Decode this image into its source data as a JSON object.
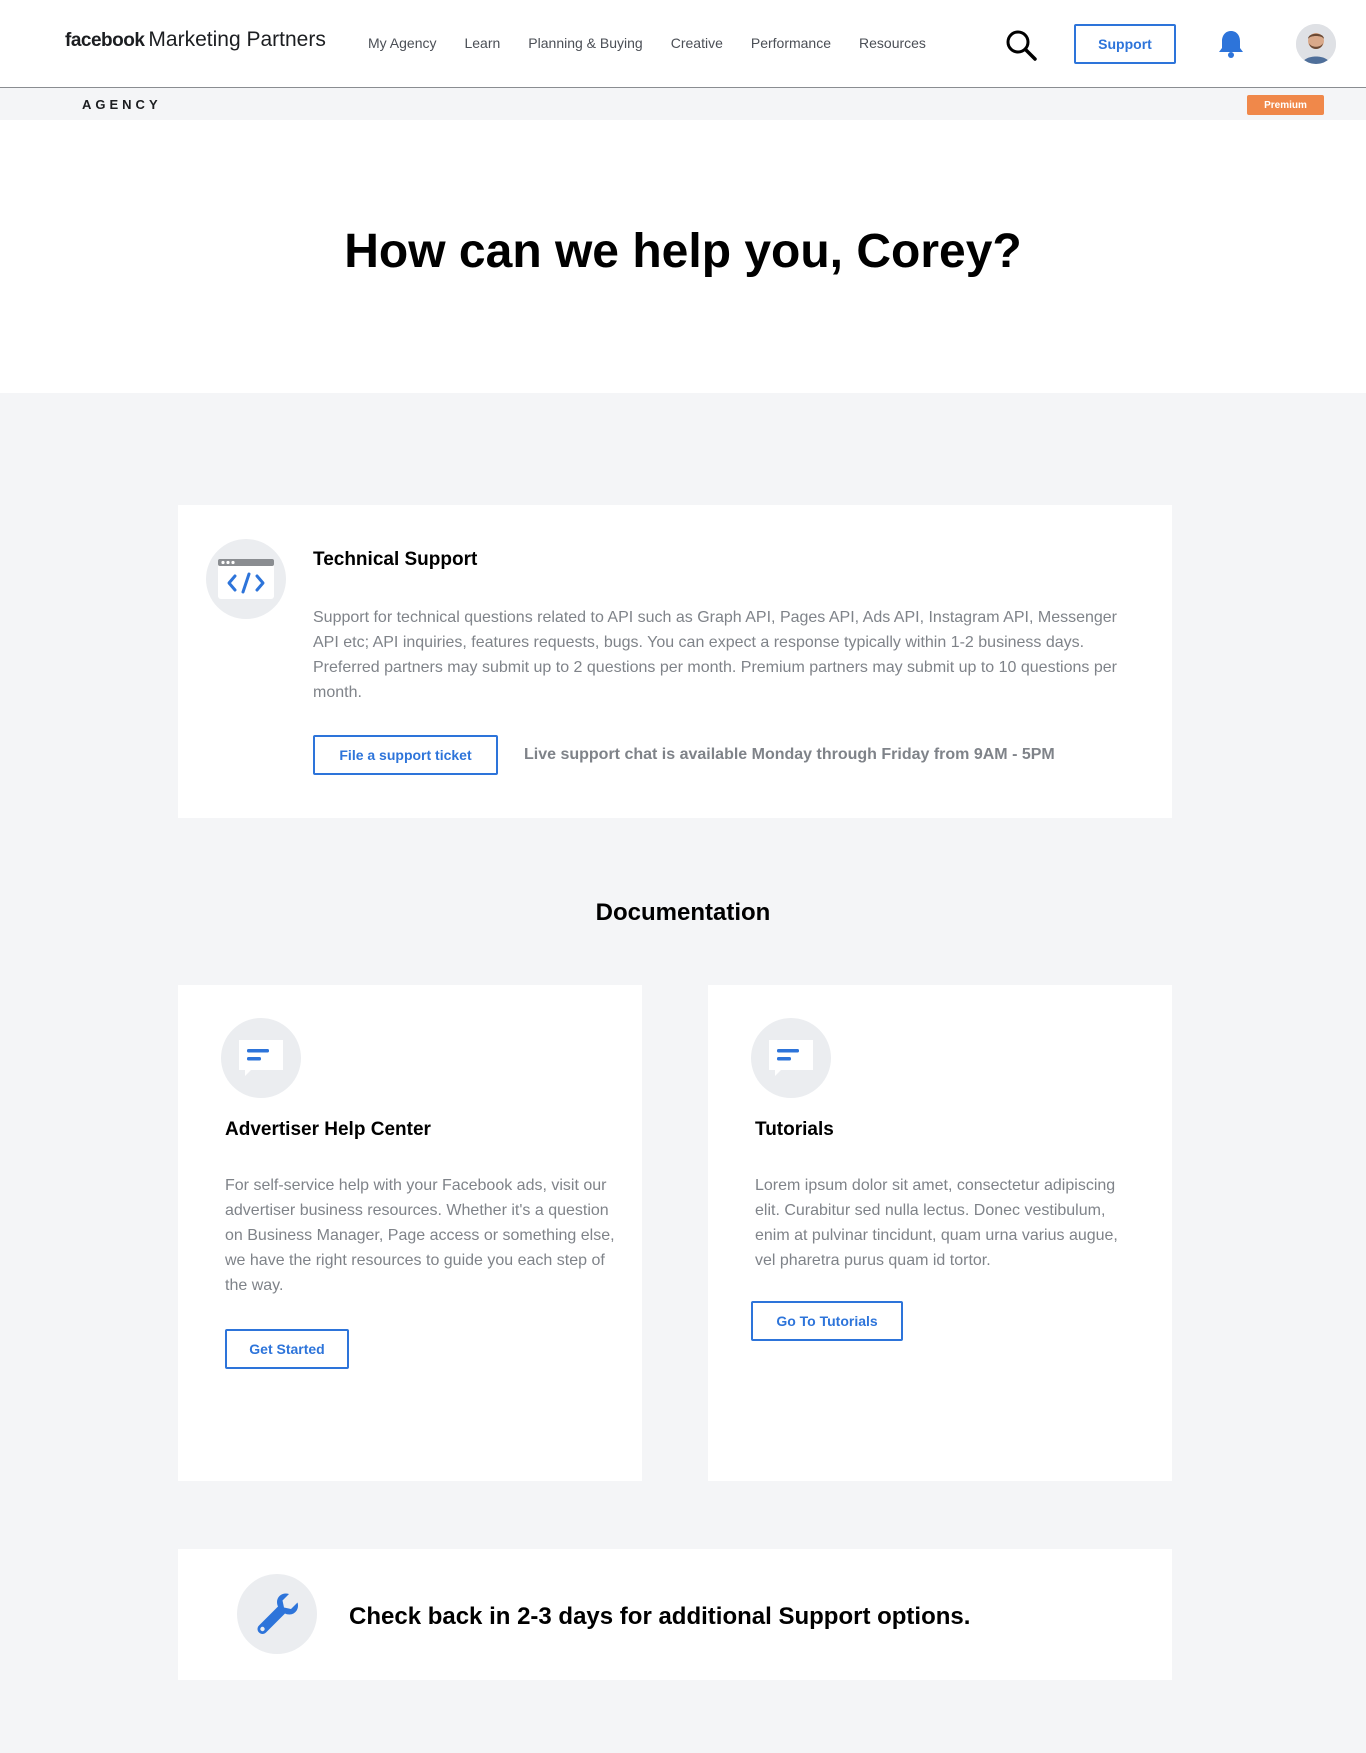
{
  "header": {
    "brand_bold": "facebook",
    "brand_rest": "Marketing Partners",
    "nav": [
      "My Agency",
      "Learn",
      "Planning & Buying",
      "Creative",
      "Performance",
      "Resources"
    ],
    "support_label": "Support",
    "icons": {
      "search": "search-icon",
      "bell": "bell-icon",
      "avatar": "user-avatar"
    }
  },
  "subbar": {
    "section": "AGENCY",
    "badge": "Premium"
  },
  "hero": {
    "title": "How can we help you, Corey?"
  },
  "technical_support": {
    "title": "Technical Support",
    "description": "Support for technical questions related to API such as Graph API, Pages API, Ads API, Instagram API, Messenger API etc; API inquiries, features requests, bugs. You can expect a response typically within 1-2 business days. Preferred partners may submit up to 2 questions per month. Premium partners may submit up to 10 questions per month.",
    "button": "File a support ticket",
    "live_chat": "Live support chat is available Monday through Friday from 9AM - 5PM",
    "icon": "code-window-icon"
  },
  "documentation": {
    "title": "Documentation",
    "cards": [
      {
        "title": "Advertiser Help Center",
        "description": "For self-service help with your Facebook ads, visit our advertiser business resources. Whether it's a question on Business Manager, Page access or something else, we have the right resources to guide you each step of the way.",
        "button": "Get Started",
        "icon": "chat-bubble-icon"
      },
      {
        "title": "Tutorials",
        "description": "Lorem ipsum dolor sit amet, consectetur adipiscing elit. Curabitur sed nulla lectus. Donec vestibulum, enim at pulvinar tincidunt, quam urna varius augue, vel pharetra purus quam id tortor.",
        "button": "Go To Tutorials",
        "icon": "chat-bubble-icon"
      }
    ]
  },
  "check_back": {
    "message": "Check back in 2-3 days for additional Support options.",
    "icon": "wrench-icon"
  },
  "colors": {
    "accent": "#2d74da",
    "badge": "#f0884a",
    "page_bg": "#f4f5f7"
  }
}
